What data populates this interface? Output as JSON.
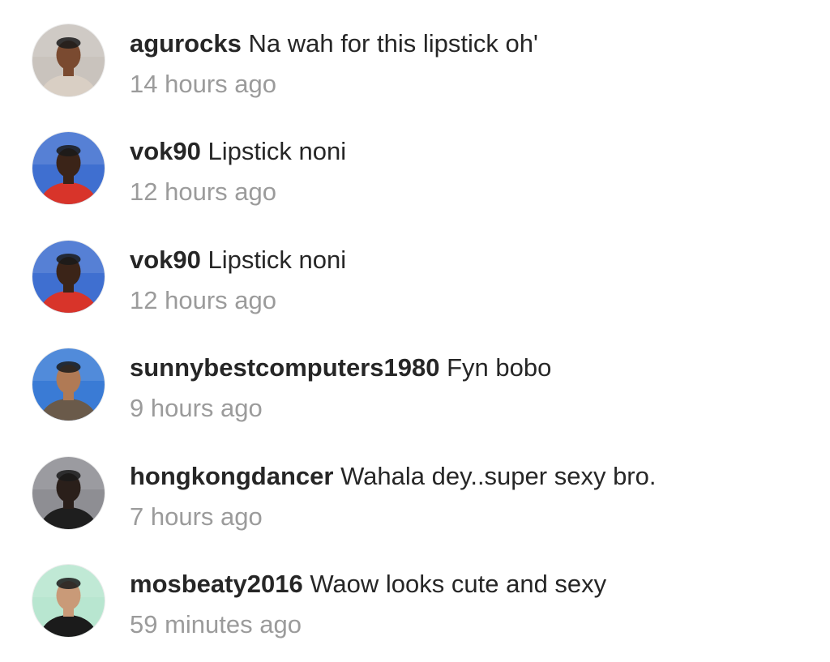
{
  "comments": [
    {
      "username": "agurocks",
      "text": "Na wah for this lipstick oh'",
      "time": "14 hours ago",
      "avatar_icon": "profile-photo-icon",
      "avatar_colors": {
        "bg": "#c9c3bd",
        "skin": "#7a4a30",
        "shirt": "#d9cfc4"
      }
    },
    {
      "username": "vok90",
      "text": "Lipstick noni",
      "time": "12 hours ago",
      "avatar_icon": "profile-photo-icon",
      "avatar_colors": {
        "bg": "#3f6fd0",
        "skin": "#3b2418",
        "shirt": "#d8342a"
      }
    },
    {
      "username": "vok90",
      "text": "Lipstick noni",
      "time": "12 hours ago",
      "avatar_icon": "profile-photo-icon",
      "avatar_colors": {
        "bg": "#3f6fd0",
        "skin": "#3b2418",
        "shirt": "#d8342a"
      }
    },
    {
      "username": "sunnybestcomputers1980",
      "text": "Fyn bobo",
      "time": "9 hours ago",
      "avatar_icon": "profile-photo-icon",
      "avatar_colors": {
        "bg": "#3a7bd5",
        "skin": "#b07a55",
        "shirt": "#6a5a4a"
      }
    },
    {
      "username": "hongkongdancer",
      "text": "Wahala dey..super sexy bro.",
      "time": "7 hours ago",
      "avatar_icon": "profile-photo-icon",
      "avatar_colors": {
        "bg": "#8e8e93",
        "skin": "#2a1f1a",
        "shirt": "#1e1e1e"
      }
    },
    {
      "username": "mosbeaty2016",
      "text": "Waow looks cute and sexy",
      "time": "59 minutes ago",
      "avatar_icon": "profile-photo-icon",
      "avatar_colors": {
        "bg": "#b8e6d0",
        "skin": "#c99a78",
        "shirt": "#1b1b1b"
      }
    }
  ]
}
